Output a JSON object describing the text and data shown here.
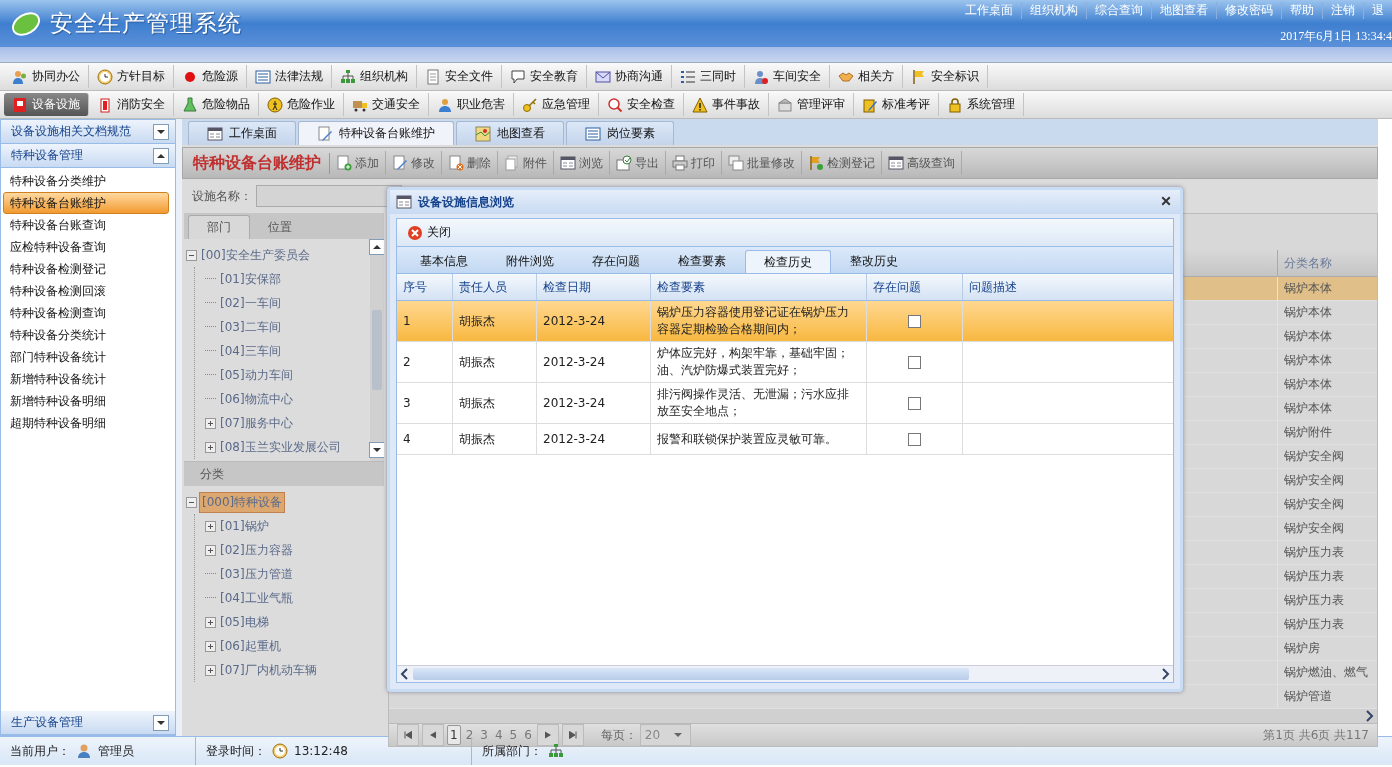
{
  "header": {
    "title": "安全生产管理系统",
    "links": [
      "工作桌面",
      "组织机构",
      "综合查询",
      "地图查看",
      "修改密码",
      "帮助",
      "注销",
      "退"
    ],
    "datetime": "2017年6月1日 13:34:4"
  },
  "menu_rows": [
    [
      {
        "label": "协同办公",
        "selected": false
      },
      {
        "label": "方针目标",
        "selected": false
      },
      {
        "label": "危险源",
        "selected": false
      },
      {
        "label": "法律法规",
        "selected": false
      },
      {
        "label": "组织机构",
        "selected": false
      },
      {
        "label": "安全文件",
        "selected": false
      },
      {
        "label": "安全教育",
        "selected": false
      },
      {
        "label": "协商沟通",
        "selected": false
      },
      {
        "label": "三同时",
        "selected": false
      },
      {
        "label": "车间安全",
        "selected": false
      },
      {
        "label": "相关方",
        "selected": false
      },
      {
        "label": "安全标识",
        "selected": false
      }
    ],
    [
      {
        "label": "设备设施",
        "selected": true
      },
      {
        "label": "消防安全",
        "selected": false
      },
      {
        "label": "危险物品",
        "selected": false
      },
      {
        "label": "危险作业",
        "selected": false
      },
      {
        "label": "交通安全",
        "selected": false
      },
      {
        "label": "职业危害",
        "selected": false
      },
      {
        "label": "应急管理",
        "selected": false
      },
      {
        "label": "安全检查",
        "selected": false
      },
      {
        "label": "事件事故",
        "selected": false
      },
      {
        "label": "管理评审",
        "selected": false
      },
      {
        "label": "标准考评",
        "selected": false
      },
      {
        "label": "系统管理",
        "selected": false
      }
    ]
  ],
  "sidebar": {
    "sections": [
      {
        "title": "设备设施相关文档规范",
        "expanded": false
      },
      {
        "title": "特种设备管理",
        "expanded": true,
        "items": [
          {
            "label": "特种设备分类维护",
            "selected": false
          },
          {
            "label": "特种设备台账维护",
            "selected": true
          },
          {
            "label": "特种设备台账查询",
            "selected": false
          },
          {
            "label": "应检特种设备查询",
            "selected": false
          },
          {
            "label": "特种设备检测登记",
            "selected": false
          },
          {
            "label": "特种设备检测回滚",
            "selected": false
          },
          {
            "label": "特种设备检测查询",
            "selected": false
          },
          {
            "label": "特种设备分类统计",
            "selected": false
          },
          {
            "label": "部门特种设备统计",
            "selected": false
          },
          {
            "label": "新增特种设备统计",
            "selected": false
          },
          {
            "label": "新增特种设备明细",
            "selected": false
          },
          {
            "label": "超期特种设备明细",
            "selected": false
          }
        ]
      },
      {
        "title": "生产设备管理",
        "expanded": false
      }
    ]
  },
  "tabs": [
    {
      "label": "工作桌面",
      "selected": false
    },
    {
      "label": "特种设备台账维护",
      "selected": true
    },
    {
      "label": "地图查看",
      "selected": false
    },
    {
      "label": "岗位要素",
      "selected": false
    }
  ],
  "panel": {
    "title": "特种设备台账维护",
    "tools": [
      "添加",
      "修改",
      "删除",
      "附件",
      "浏览",
      "导出",
      "打印",
      "批量修改",
      "检测登记",
      "高级查询"
    ]
  },
  "filter": {
    "label": "设施名称："
  },
  "tree_tabs": [
    {
      "label": "部门",
      "selected": true
    },
    {
      "label": "位置",
      "selected": false
    }
  ],
  "dept_tree": [
    {
      "label": "[00]安全生产委员会",
      "expanded": true,
      "selected": false,
      "children": [
        {
          "label": "[01]安保部",
          "selected": false
        },
        {
          "label": "[02]一车间",
          "selected": false
        },
        {
          "label": "[03]二车间",
          "selected": false
        },
        {
          "label": "[04]三车间",
          "selected": false
        },
        {
          "label": "[05]动力车间",
          "selected": false
        },
        {
          "label": "[06]物流中心",
          "selected": false
        },
        {
          "label": "[07]服务中心",
          "expanded": false,
          "selected": false
        },
        {
          "label": "[08]玉兰实业发展公司",
          "expanded": false,
          "selected": false
        }
      ]
    }
  ],
  "category": {
    "title": "分类",
    "tree": [
      {
        "label": "[000]特种设备",
        "expanded": true,
        "selected": true,
        "children": [
          {
            "label": "[01]锅炉",
            "expanded": false,
            "selected": false
          },
          {
            "label": "[02]压力容器",
            "expanded": false,
            "selected": false
          },
          {
            "label": "[03]压力管道",
            "selected": false
          },
          {
            "label": "[04]工业气瓶",
            "selected": false
          },
          {
            "label": "[05]电梯",
            "expanded": false,
            "selected": false
          },
          {
            "label": "[06]起重机",
            "expanded": false,
            "selected": false
          },
          {
            "label": "[07]厂内机动车辆",
            "expanded": false,
            "selected": false
          }
        ]
      }
    ]
  },
  "grid": {
    "column": "分类名称",
    "rows": [
      {
        "cell": "锅炉本体",
        "selected": true
      },
      {
        "cell": "锅炉本体",
        "selected": false
      },
      {
        "cell": "锅炉本体",
        "selected": false
      },
      {
        "cell": "锅炉本体",
        "selected": false
      },
      {
        "cell": "锅炉本体",
        "selected": false
      },
      {
        "cell": "锅炉本体",
        "selected": false
      },
      {
        "cell": "锅炉附件",
        "selected": false
      },
      {
        "cell": "锅炉安全阀",
        "selected": false
      },
      {
        "cell": "锅炉安全阀",
        "selected": false
      },
      {
        "cell": "锅炉安全阀",
        "selected": false
      },
      {
        "cell": "锅炉安全阀",
        "selected": false
      },
      {
        "cell": "锅炉压力表",
        "selected": false
      },
      {
        "cell": "锅炉压力表",
        "selected": false
      },
      {
        "cell": "锅炉压力表",
        "selected": false
      },
      {
        "cell": "锅炉压力表",
        "selected": false
      },
      {
        "cell": "锅炉房",
        "selected": false
      },
      {
        "cell": "锅炉燃油、燃气",
        "selected": false
      },
      {
        "cell": "锅炉管道",
        "selected": false
      }
    ]
  },
  "pager": {
    "pages": [
      {
        "label": "1",
        "selected": true
      },
      {
        "label": "2",
        "selected": false
      },
      {
        "label": "3",
        "selected": false
      },
      {
        "label": "4",
        "selected": false
      },
      {
        "label": "5",
        "selected": false
      },
      {
        "label": "6",
        "selected": false
      }
    ],
    "per_page_label": "每页：",
    "per_page": "20",
    "summary": "第1页 共6页 共117"
  },
  "dialog": {
    "title": "设备设施信息浏览",
    "close_label": "关闭",
    "tabs": [
      {
        "label": "基本信息",
        "selected": false
      },
      {
        "label": "附件浏览",
        "selected": false
      },
      {
        "label": "存在问题",
        "selected": false
      },
      {
        "label": "检查要素",
        "selected": false
      },
      {
        "label": "检查历史",
        "selected": true
      },
      {
        "label": "整改历史",
        "selected": false
      }
    ],
    "columns": [
      "序号",
      "责任人员",
      "检查日期",
      "检查要素",
      "存在问题",
      "问题描述"
    ],
    "rows": [
      {
        "no": "1",
        "person": "胡振杰",
        "date": "2012-3-24",
        "item": "锅炉压力容器使用登记证在锅炉压力容器定期检验合格期间内；",
        "has_problem": false,
        "selected": true
      },
      {
        "no": "2",
        "person": "胡振杰",
        "date": "2012-3-24",
        "item": "炉体应完好，构架牢靠，基础牢固；油、汽炉防爆式装置完好；",
        "has_problem": false,
        "selected": false
      },
      {
        "no": "3",
        "person": "胡振杰",
        "date": "2012-3-24",
        "item": "排污阀操作灵活、无泄漏；污水应排放至安全地点；",
        "has_problem": false,
        "selected": false
      },
      {
        "no": "4",
        "person": "胡振杰",
        "date": "2012-3-24",
        "item": "报警和联锁保护装置应灵敏可靠。",
        "has_problem": false,
        "selected": false
      }
    ]
  },
  "status_bar": {
    "user_label": "当前用户：",
    "user": "管理员",
    "login_label": "登录时间：",
    "login_time": "13:12:48",
    "dept_label": "所属部门："
  }
}
